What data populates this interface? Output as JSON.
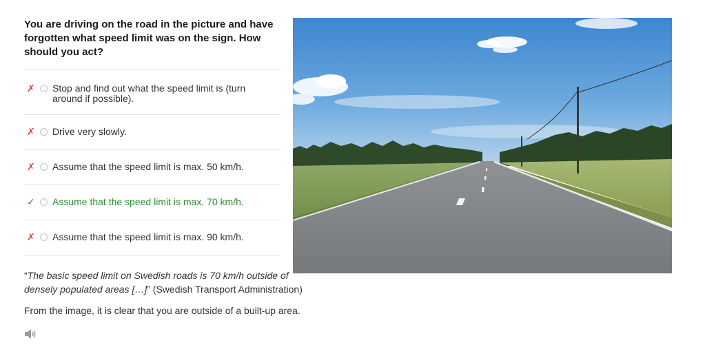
{
  "question": {
    "text": "You are driving on the road in the picture and have forgotten what speed limit was on the sign. How should you act?"
  },
  "options": [
    {
      "mark": "✗",
      "label": "Stop and find out what the speed limit is (turn around if possible).",
      "correct": false
    },
    {
      "mark": "✗",
      "label": "Drive very slowly.",
      "correct": false
    },
    {
      "mark": "✗",
      "label": "Assume that the speed limit is max. 50 km/h.",
      "correct": false
    },
    {
      "mark": "✓",
      "label": "Assume that the speed limit is max. 70 km/h.",
      "correct": true
    },
    {
      "mark": "✗",
      "label": "Assume that the speed limit is max. 90 km/h.",
      "correct": false
    }
  ],
  "explanation": {
    "quote_open": "“",
    "quote_text": "The basic speed limit on Swedish roads is 70 km/h outside of densely populated areas […]",
    "quote_close": "”",
    "source": " (Swedish Transport Administration)",
    "conclusion": "From the image, it is clear that you are outside of a built-up area."
  },
  "icons": {
    "audio": "speaker-icon",
    "wrong": "cross-icon",
    "right": "check-icon"
  },
  "colors": {
    "wrong": "#e2453c",
    "correct": "#2e8a2e",
    "divider": "#e2e2e2"
  }
}
